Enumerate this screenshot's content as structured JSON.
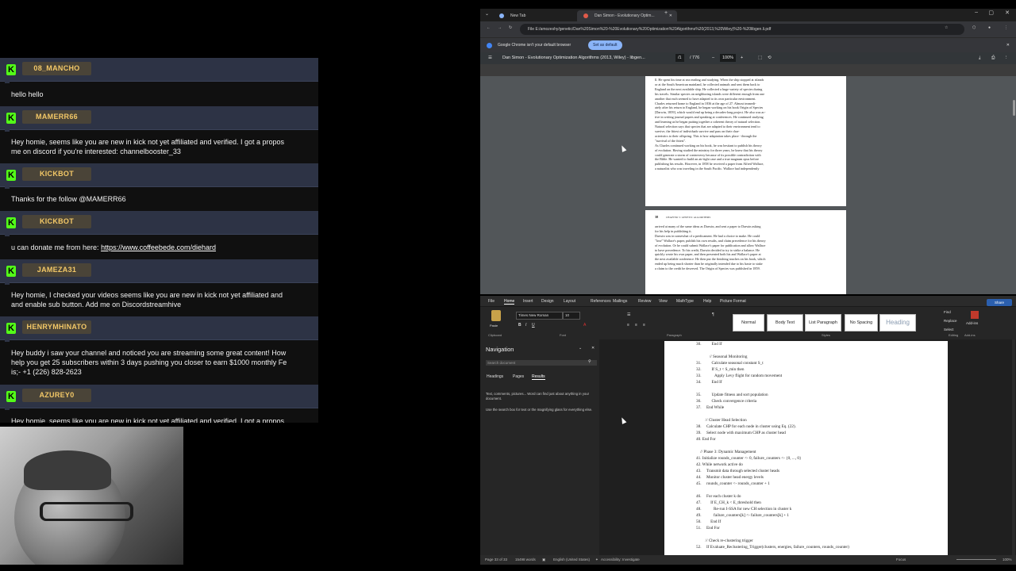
{
  "chat": {
    "messages": [
      {
        "user": "08_MANCHO",
        "lines": [
          "hello hello"
        ]
      },
      {
        "user": "MAMERR66",
        "lines": [
          "Hey homie, seems like you are new in kick not yet affiliated and verified. I got a propos",
          "me on discord if you're interested: channelbooster_33"
        ]
      },
      {
        "user": "KICKBOT",
        "lines": [
          "Thanks for the follow @MAMERR66"
        ]
      },
      {
        "user": "KICKBOT",
        "lines": [
          "u can donate me from here: "
        ],
        "link": "https://www.coffeebede.com/diehard"
      },
      {
        "user": "JAMEZA31",
        "lines": [
          "Hey homie, I checked your videos seems like you are new in kick not yet affiliated and",
          "and enable sub button. Add me on Discordstreamhive"
        ]
      },
      {
        "user": "HENRYMHINATO",
        "lines": [
          "Hey buddy i saw your channel and noticed you are streaming some great content! How",
          "help you get 25 subscribers within 3 days pushing you closer to earn $1000 monthly Fe",
          "is;- +1 (226) 828-2623"
        ]
      },
      {
        "user": "AZUREY0",
        "lines": [
          "Hey homie, seems like you are new in kick not yet affiliated and verified. I got a propos"
        ]
      }
    ]
  },
  "browser": {
    "tabs": [
      "New Tab",
      "Dan Simon - Evolutionary Optim..."
    ],
    "url": "File   E:/amozeshy/genetic/Dan%20Simon%20-%20Evolutionary%20Optimization%20Algorithms%20(2013,%20Wiley)%20-%20libgen.li.pdf",
    "infobar_text": "Google Chrome isn't your default browser",
    "infobar_button": "Set as default",
    "pdf_title": "Dan Simon - Evolutionary Optimization Algorithms (2013, Wiley) - libgen...",
    "pdf_page": "/1",
    "pdf_total": "/ 776",
    "pdf_zoom": "100%",
    "page1_lines": [
      "ll. He spent his time at sea reading and studying. When the ship stopped at islands",
      "or at the South American mainland, he collected animals and sent them back to",
      "England on the next available ship. He collected a huge variety of species during",
      "his travels. Similar species on neighboring islands were different enough from one",
      "another that each seemed to have adapted to its own particular environment.",
      "   Charles returned home to England in 1836 at the age of 27. Almost immedi-",
      "ately after his return to England, he began working on his book Origin of Species",
      "[Darwin, 1859], which would end up being a decades-long project. He also was ac-",
      "tive in writing journal papers and speaking at conferences. He continued studying",
      "and learning as he began putting together a coherent theory of natural selection.",
      "Natural selection says that species that are adapted to their environment tend to",
      "survive, the fittest of individuals survive and pass on their char-",
      "acteristics to their offspring. This is how adaptation takes place - through the",
      "\"survival of the fittest\".",
      "   As Charles continued working on his book, he was hesitant to publish his theory",
      "of evolution. Having studied the ministry for three years, he knew that his theory",
      "could generate a storm of controversy because of its possible contradiction with",
      "the Bible. He wanted to build an air-tight case and a true magnum opus before",
      "publishing his results. However, in 1858 he received a paper from Alfred Wallace,",
      "a naturalist who was traveling in the South Pacific. Wallace had independently"
    ],
    "page2_header_num": "38",
    "page2_header_title": "CHAPTER 3: GENETIC ALGORITHMS",
    "page2_lines": [
      "arrived at many of the same ideas as Darwin, and sent a paper to Darwin asking",
      "for his help in publishing it.",
      "   Darwin was in somewhat of a predicament. He had a choice to make. He could",
      "\"lose\" Wallace's paper, publish his own results, and claim precedence for his theory",
      "of evolution. Or he could submit Wallace's paper for publication and allow Wallace",
      "to have precedence. To his credit, Darwin decided to try to strike a balance. He",
      "quickly wrote his own paper, and then presented both his and Wallace's paper at",
      "the next available conference. He then put the finishing touches on his book, which",
      "ended up being much shorter than he originally intended due to his haste to stake",
      "a claim to the credit he deserved. The Origin of Species was published in 1859."
    ]
  },
  "word": {
    "menu": [
      "File",
      "Home",
      "Insert",
      "Design",
      "Layout",
      "References",
      "Mailings",
      "Review",
      "View",
      "MathType",
      "Help",
      "Picture Format"
    ],
    "share": "Share",
    "font": "Times New Roman",
    "font_size": "10",
    "styles": [
      "Normal",
      "Body Text",
      "List Paragraph",
      "No Spacing",
      "Heading"
    ],
    "groups": [
      "Clipboard",
      "Font",
      "Paragraph",
      "Styles",
      "Editing",
      "Add-ins"
    ],
    "editing": [
      "Find",
      "Replace",
      "Select"
    ],
    "addins": "Add-ins",
    "paste": "Paste",
    "nav_title": "Navigation",
    "nav_search": "Search document",
    "nav_tabs": [
      "Headings",
      "Pages",
      "Results"
    ],
    "nav_text1": "Text, comments, pictures... Word can find just about anything in your document.",
    "nav_text2": "Use the search box for text or the magnifying glass for everything else.",
    "doc_lines": [
      "30.          End If",
      "",
      "             // Seasonal Monitoring",
      "31.          Calculate seasonal constant S_t",
      "32.          If S_t < S_min then",
      "33.             Apply Levy flight for random movement",
      "34.          End If",
      "",
      "35.          Update fitness and sort population",
      "36.          Check convergence criteria",
      "37.     End While",
      "",
      "         // Cluster Head Selection",
      "38.     Calculate CHP for each node in cluster using Eq. (22).",
      "39.     Select node with maximum CHP as cluster head",
      "40. End For",
      "",
      "    // Phase 3: Dynamic Management",
      "41. Initialize rounds_counter <- 0, failure_counters <- {0, ..., 0}",
      "42. While network active do",
      "43.     Transmit data through selected cluster heads",
      "44.     Monitor cluster head energy levels",
      "45.     rounds_counter <- rounds_counter + 1",
      "",
      "46.     For each cluster k do",
      "47.         If E_CH_k < E_threshold then",
      "48.            Re-run I-SSA for new CH selection in cluster k",
      "49.            failure_counters[k] <- failure_counters[k] + 1",
      "50.         End If",
      "51.     End For",
      "",
      "         // Check re-clustering trigger",
      "52.     If Evaluate_Reclustering_Trigger(clusters, energies, failure_counters, rounds_counter)"
    ],
    "status_page": "Page 33 of 33",
    "status_words": "15498 words",
    "status_lang": "English (United States)",
    "status_access": "Accessibility: Investigate",
    "status_focus": "Focus",
    "status_zoom": "100%"
  },
  "colors": {
    "kick_green": "#53fc18",
    "username_gold": "#f3c867",
    "chat_header_bg": "#2d3345"
  }
}
